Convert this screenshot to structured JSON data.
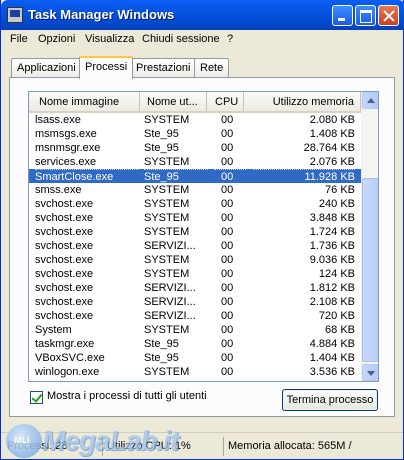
{
  "window": {
    "title": "Task Manager Windows"
  },
  "menu": [
    "File",
    "Opzioni",
    "Visualizza",
    "Chiudi sessione",
    "?"
  ],
  "tabs": [
    "Applicazioni",
    "Processi",
    "Prestazioni",
    "Rete"
  ],
  "active_tab": "Processi",
  "columns": {
    "name": "Nome immagine",
    "user": "Nome ut...",
    "cpu": "CPU",
    "mem": "Utilizzo memoria"
  },
  "processes": [
    {
      "name": "lsass.exe",
      "user": "SYSTEM",
      "cpu": "00",
      "mem": "2.080 KB"
    },
    {
      "name": "msmsgs.exe",
      "user": "Ste_95",
      "cpu": "00",
      "mem": "1.408 KB"
    },
    {
      "name": "msnmsgr.exe",
      "user": "Ste_95",
      "cpu": "00",
      "mem": "28.764 KB"
    },
    {
      "name": "services.exe",
      "user": "SYSTEM",
      "cpu": "00",
      "mem": "2.076 KB"
    },
    {
      "name": "SmartClose.exe",
      "user": "Ste_95",
      "cpu": "00",
      "mem": "11.928 KB",
      "selected": true
    },
    {
      "name": "smss.exe",
      "user": "SYSTEM",
      "cpu": "00",
      "mem": "76 KB"
    },
    {
      "name": "svchost.exe",
      "user": "SYSTEM",
      "cpu": "00",
      "mem": "240 KB"
    },
    {
      "name": "svchost.exe",
      "user": "SYSTEM",
      "cpu": "00",
      "mem": "3.848 KB"
    },
    {
      "name": "svchost.exe",
      "user": "SYSTEM",
      "cpu": "00",
      "mem": "1.724 KB"
    },
    {
      "name": "svchost.exe",
      "user": "SERVIZI...",
      "cpu": "00",
      "mem": "1.736 KB"
    },
    {
      "name": "svchost.exe",
      "user": "SYSTEM",
      "cpu": "00",
      "mem": "9.036 KB"
    },
    {
      "name": "svchost.exe",
      "user": "SYSTEM",
      "cpu": "00",
      "mem": "124 KB"
    },
    {
      "name": "svchost.exe",
      "user": "SERVIZI...",
      "cpu": "00",
      "mem": "1.812 KB"
    },
    {
      "name": "svchost.exe",
      "user": "SERVIZI...",
      "cpu": "00",
      "mem": "2.108 KB"
    },
    {
      "name": "svchost.exe",
      "user": "SERVIZI...",
      "cpu": "00",
      "mem": "720 KB"
    },
    {
      "name": "System",
      "user": "SYSTEM",
      "cpu": "00",
      "mem": "68 KB"
    },
    {
      "name": "taskmgr.exe",
      "user": "Ste_95",
      "cpu": "00",
      "mem": "4.884 KB"
    },
    {
      "name": "VBoxSVC.exe",
      "user": "Ste_95",
      "cpu": "00",
      "mem": "1.404 KB"
    },
    {
      "name": "winlogon.exe",
      "user": "SYSTEM",
      "cpu": "00",
      "mem": "3.536 KB"
    }
  ],
  "show_all_users": {
    "label": "Mostra i processi di tutti gli utenti",
    "checked": true
  },
  "end_process_button": "Termina processo",
  "status": {
    "processes": "Processi: 28",
    "cpu": "Utilizzo CPU: 1%",
    "memory": "Memoria allocata: 565M /"
  },
  "watermark": {
    "brand": "MegaLab.it",
    "badge": "MLI"
  },
  "colors": {
    "selection": "#316ac5",
    "title_bar": "#0553e0",
    "tab_highlight": "#ffc83c"
  },
  "icons": [
    "taskmgr-app-icon",
    "minimize-icon",
    "maximize-icon",
    "close-icon",
    "scroll-up-icon",
    "scroll-down-icon",
    "checkmark-icon"
  ]
}
